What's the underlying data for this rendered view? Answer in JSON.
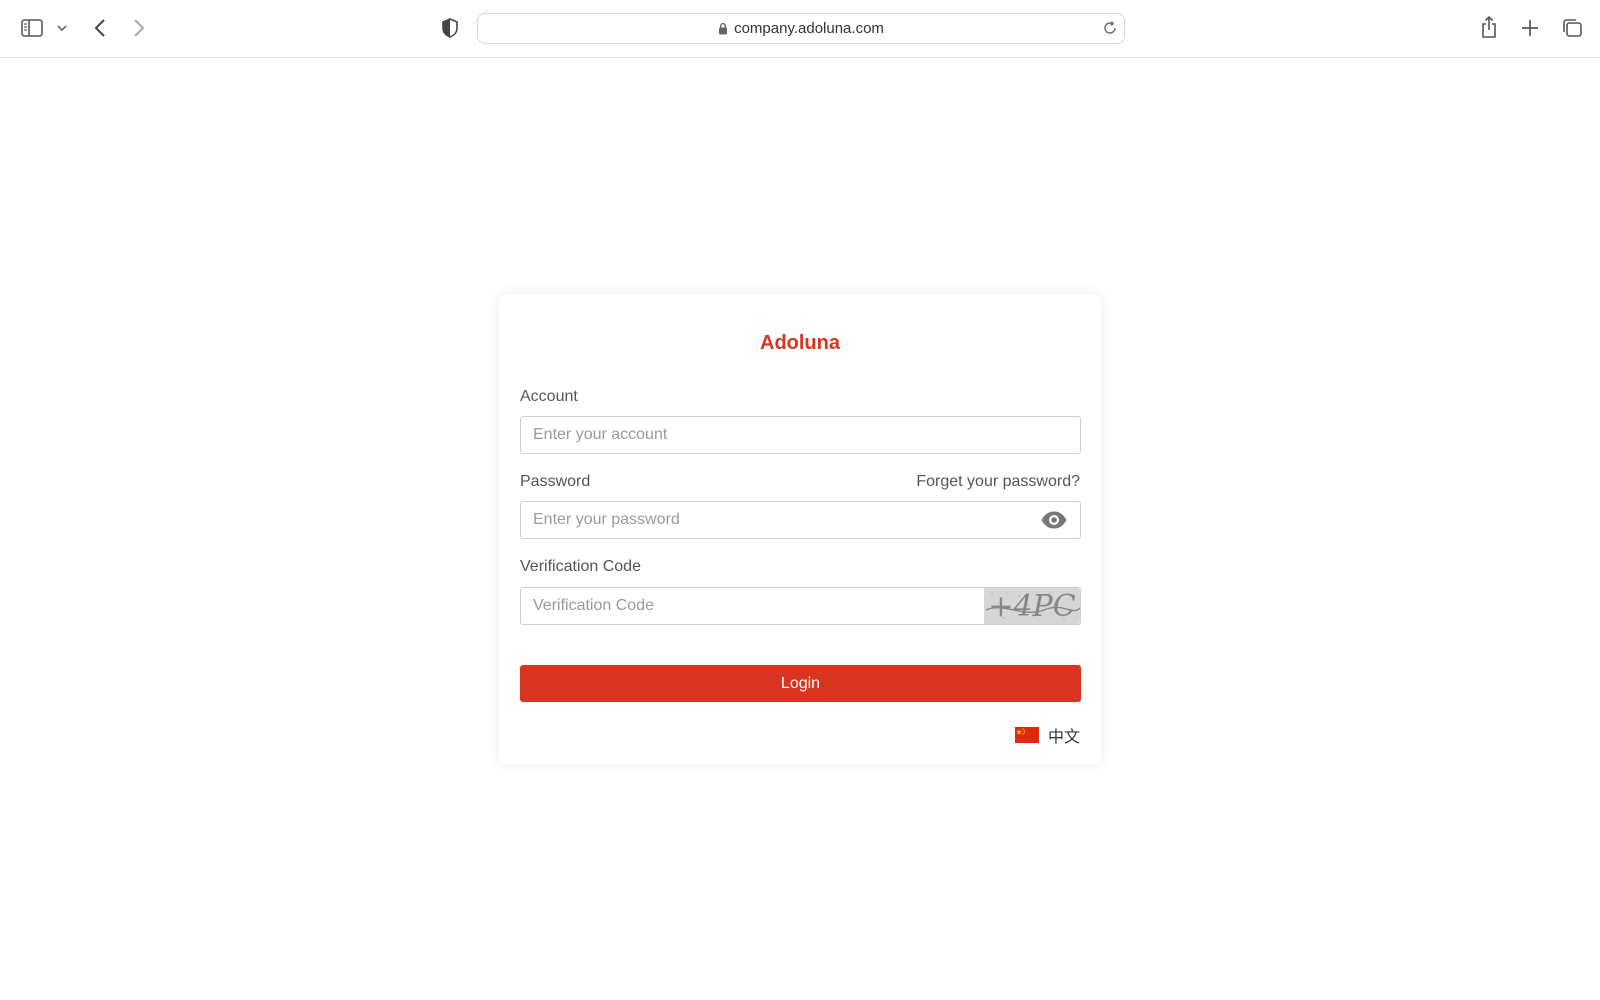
{
  "browser": {
    "url": "company.adoluna.com"
  },
  "login": {
    "brand": "Adoluna",
    "account_label": "Account",
    "account_placeholder": "Enter your account",
    "password_label": "Password",
    "forgot_link": "Forget your password?",
    "password_placeholder": "Enter your password",
    "verification_label": "Verification Code",
    "verification_placeholder": "Verification Code",
    "captcha_text": "+4PC",
    "login_button": "Login",
    "language": "中文"
  },
  "colors": {
    "accent": "#d9341f"
  },
  "icons": [
    "sidebar-icon",
    "chevron-down-icon",
    "back-icon",
    "forward-icon",
    "shield-icon",
    "lock-icon",
    "reload-icon",
    "share-icon",
    "new-tab-icon",
    "tabs-overview-icon",
    "eye-icon",
    "china-flag-icon"
  ]
}
